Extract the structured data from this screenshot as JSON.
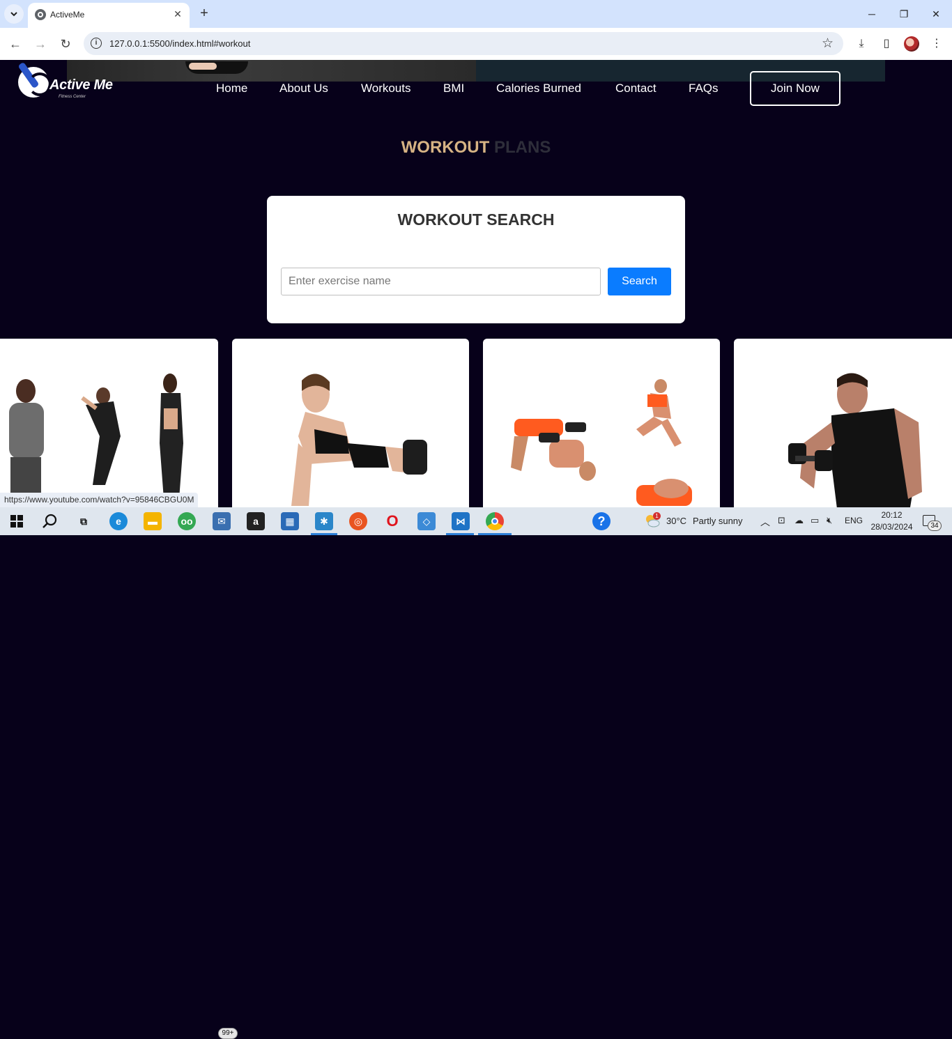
{
  "browser": {
    "tab_title": "ActiveMe",
    "url": "127.0.0.1:5500/index.html#workout",
    "status_url": "https://www.youtube.com/watch?v=95846CBGU0M"
  },
  "site": {
    "logo_text": "Active Me",
    "logo_sub": "Fitness Center",
    "nav": [
      "Home",
      "About Us",
      "Workouts",
      "BMI",
      "Calories Burned",
      "Contact",
      "FAQs"
    ],
    "join_label": "Join Now"
  },
  "section": {
    "title_part1": "WORKOUT",
    "title_part2": "PLANS"
  },
  "search": {
    "heading": "WORKOUT SEARCH",
    "placeholder": "Enter exercise name",
    "button_label": "Search"
  },
  "taskbar": {
    "weather_temp": "30°C",
    "weather_text": "Partly sunny",
    "language": "ENG",
    "time": "20:12",
    "date": "28/03/2024",
    "notification_count": "34",
    "mail_badge": "99+",
    "weather_badge": "1"
  },
  "colors": {
    "page_bg": "#07011a",
    "accent_gold": "#d6b384",
    "search_blue": "#0a7cff"
  }
}
